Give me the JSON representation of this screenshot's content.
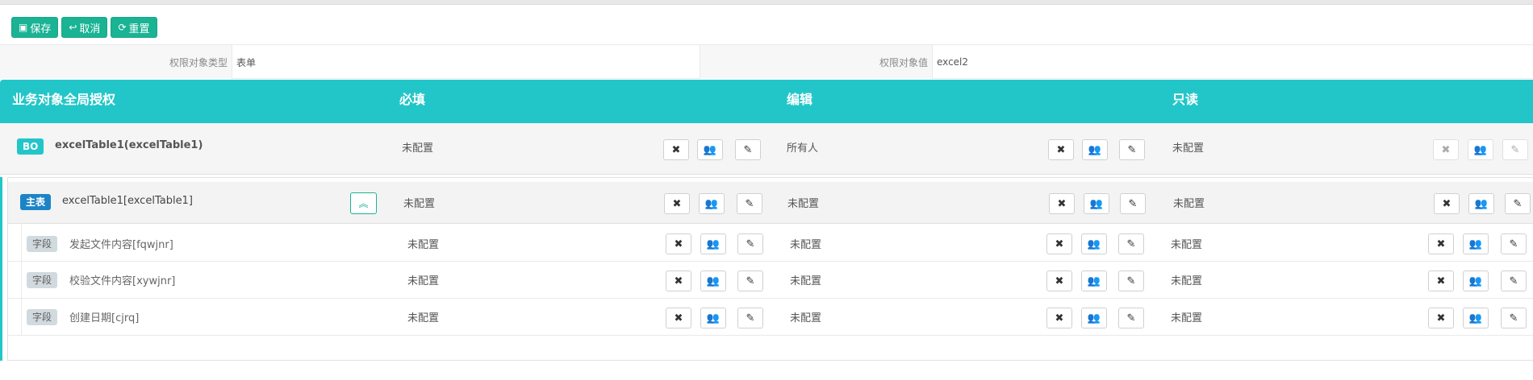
{
  "toolbar": {
    "save_label": "保存",
    "cancel_label": "取消",
    "reset_label": "重置"
  },
  "info": {
    "type_label": "权限对象类型",
    "type_value": "表单",
    "value_label": "权限对象值",
    "value_value": "excel2"
  },
  "header": {
    "col0": "业务对象全局授权",
    "col1": "必填",
    "col2": "编辑",
    "col3": "只读"
  },
  "bo": {
    "badge": "BO",
    "name": "excelTable1(excelTable1)",
    "required": "未配置",
    "edit": "所有人",
    "readonly": "未配置"
  },
  "main": {
    "badge": "主表",
    "name": "excelTable1[excelTable1]",
    "required": "未配置",
    "edit": "未配置",
    "readonly": "未配置"
  },
  "fields": [
    {
      "badge": "字段",
      "name": "发起文件内容[fqwjnr]",
      "required": "未配置",
      "edit": "未配置",
      "readonly": "未配置"
    },
    {
      "badge": "字段",
      "name": "校验文件内容[xywjnr]",
      "required": "未配置",
      "edit": "未配置",
      "readonly": "未配置"
    },
    {
      "badge": "字段",
      "name": "创建日期[cjrq]",
      "required": "未配置",
      "edit": "未配置",
      "readonly": "未配置"
    }
  ],
  "icons": {
    "clear": "times-icon",
    "group": "users-icon",
    "edit": "edit-icon",
    "collapse": "chevron-double-up-icon"
  },
  "colors": {
    "primary": "#1ab394",
    "header": "#23c6c8",
    "main_badge": "#1c84c6"
  }
}
